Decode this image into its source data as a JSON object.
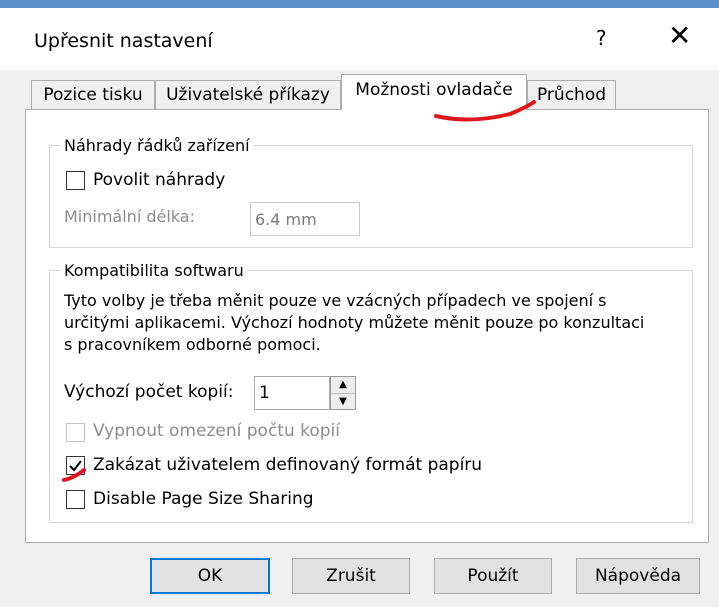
{
  "window": {
    "title": "Upřesnit nastavení",
    "help_label": "?",
    "close_label": "✕"
  },
  "tabs": [
    {
      "label": "Pozice tisku",
      "active": false
    },
    {
      "label": "Uživatelské příkazy",
      "active": false
    },
    {
      "label": "Možnosti ovladače",
      "active": true
    },
    {
      "label": "Průchod",
      "active": false
    }
  ],
  "line_replacement": {
    "legend": "Náhrady řádků zařízení",
    "enable_label": "Povolit náhrady",
    "enable_checked": false,
    "min_length_label": "Minimální délka:",
    "min_length_value": "6.4 mm"
  },
  "compat": {
    "legend": "Kompatibilita softwaru",
    "info_lines": [
      "Tyto volby je třeba měnit pouze ve vzácných případech ve spojení s",
      "určitými aplikacemi. Výchozí hodnoty můžete měnit pouze po konzultaci",
      "s pracovníkem odborné pomoci."
    ],
    "copies_label": "Výchozí počet kopií:",
    "copies_value": "1",
    "disable_copy_limit_label": "Vypnout omezení počtu kopií",
    "disable_copy_limit_checked": false,
    "disable_user_paper_label": "Zakázat uživatelem definovaný formát papíru",
    "disable_user_paper_checked": true,
    "disable_page_size_sharing_label": "Disable Page Size Sharing",
    "disable_page_size_sharing_checked": false
  },
  "buttons": {
    "ok": "OK",
    "cancel": "Zrušit",
    "apply": "Použít",
    "help": "Nápověda"
  },
  "colors": {
    "annotation": "#e0161c",
    "focus_border": "#0078d7"
  }
}
